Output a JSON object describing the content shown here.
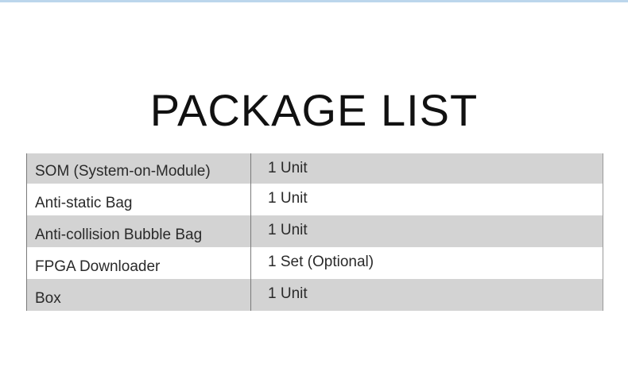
{
  "title": "PACKAGE LIST",
  "rows": [
    {
      "item": "SOM (System-on-Module)",
      "quantity": "1 Unit"
    },
    {
      "item": "Anti-static Bag",
      "quantity": "1 Unit"
    },
    {
      "item": "Anti-collision Bubble Bag",
      "quantity": "1 Unit"
    },
    {
      "item": "FPGA Downloader",
      "quantity": "1 Set (Optional)"
    },
    {
      "item": "Box",
      "quantity": "1 Unit"
    }
  ],
  "colors": {
    "row_shade": "#d3d3d3",
    "row_plain": "#ffffff",
    "top_border": "#bcd6ec",
    "text": "#2a2a2a"
  }
}
